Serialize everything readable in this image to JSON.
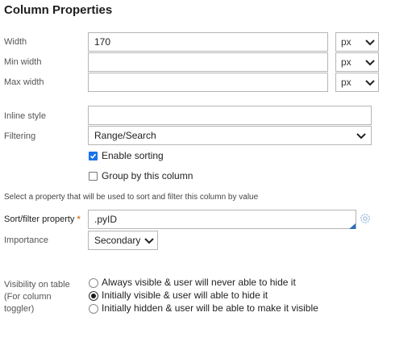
{
  "title": "Column Properties",
  "width": {
    "label": "Width",
    "value": "170",
    "unit": "px"
  },
  "min_width": {
    "label": "Min width",
    "value": "",
    "unit": "px"
  },
  "max_width": {
    "label": "Max width",
    "value": "",
    "unit": "px"
  },
  "inline_style": {
    "label": "Inline style",
    "value": ""
  },
  "filtering": {
    "label": "Filtering",
    "value": "Range/Search"
  },
  "enable_sorting": {
    "label": "Enable sorting",
    "checked": true
  },
  "group_by": {
    "label": "Group by this column",
    "checked": false
  },
  "hint": "Select a property that will be used to sort and filter this column by value",
  "sort_filter": {
    "label": "Sort/filter property",
    "required_mark": "*",
    "value": ".pyID"
  },
  "importance": {
    "label": "Importance",
    "value": "Secondary"
  },
  "visibility": {
    "label_line1": "Visibility on table",
    "label_line2": "(For column",
    "label_line3": "toggler)",
    "options": [
      {
        "label": "Always visible & user will never able to hide it",
        "selected": false
      },
      {
        "label": "Initially visible & user will able to hide it",
        "selected": true
      },
      {
        "label": "Initially hidden & user will be able to make it visible",
        "selected": false
      }
    ]
  },
  "colors": {
    "accent": "#1a73e8",
    "required": "#d9822b"
  }
}
